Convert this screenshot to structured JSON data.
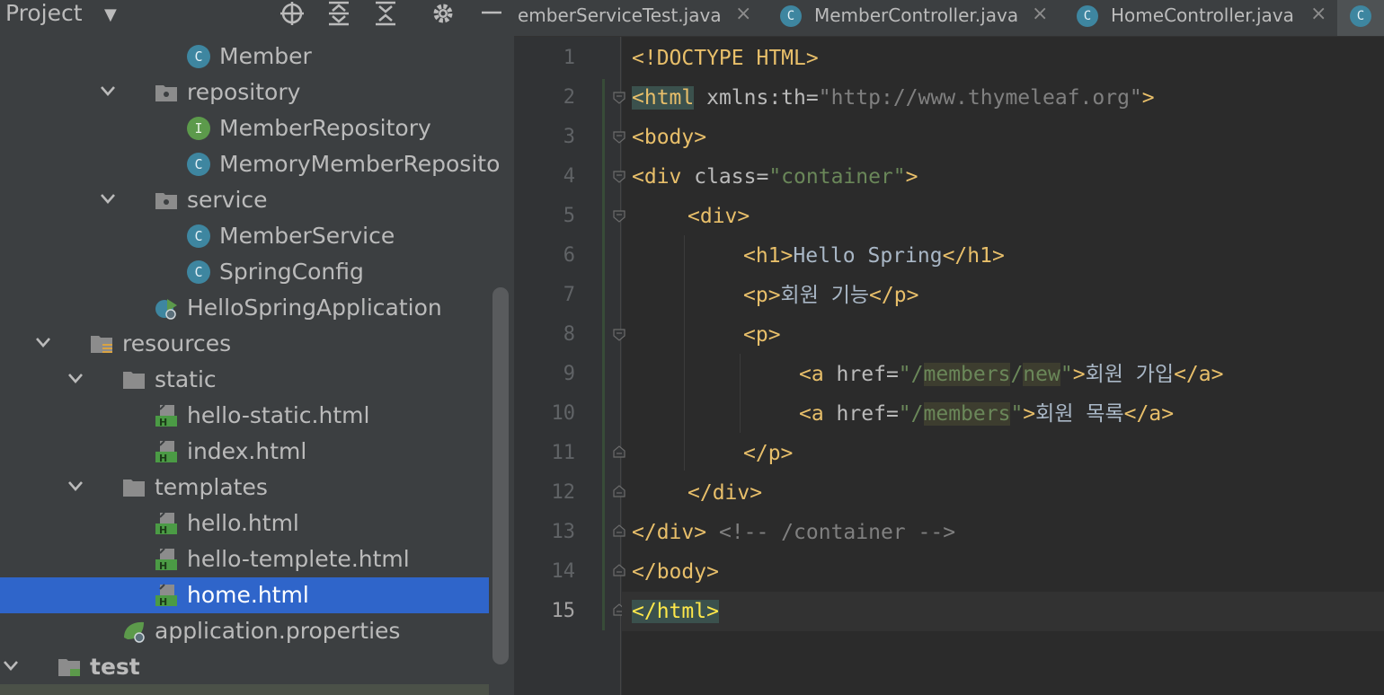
{
  "project_panel": {
    "title": "Project",
    "tree": [
      {
        "label": "Member",
        "icon": "class-c-icon",
        "indent": 3,
        "arrow": null
      },
      {
        "label": "repository",
        "icon": "package-folder-icon",
        "indent": 2,
        "arrow": "down"
      },
      {
        "label": "MemberRepository",
        "icon": "interface-i-icon",
        "indent": 3,
        "arrow": null
      },
      {
        "label": "MemoryMemberReposito",
        "icon": "class-c-icon",
        "indent": 3,
        "arrow": null
      },
      {
        "label": "service",
        "icon": "package-folder-icon",
        "indent": 2,
        "arrow": "down"
      },
      {
        "label": "MemberService",
        "icon": "class-c-icon",
        "indent": 3,
        "arrow": null
      },
      {
        "label": "SpringConfig",
        "icon": "class-c-icon",
        "indent": 3,
        "arrow": null
      },
      {
        "label": "HelloSpringApplication",
        "icon": "spring-app-icon",
        "indent": 2,
        "arrow": null
      },
      {
        "label": "resources",
        "icon": "resources-folder-icon",
        "indent": 0,
        "arrow": "down"
      },
      {
        "label": "static",
        "icon": "folder-icon",
        "indent": 1,
        "arrow": "down"
      },
      {
        "label": "hello-static.html",
        "icon": "html-file-icon",
        "indent": 2,
        "arrow": null
      },
      {
        "label": "index.html",
        "icon": "html-file-icon",
        "indent": 2,
        "arrow": null
      },
      {
        "label": "templates",
        "icon": "folder-icon",
        "indent": 1,
        "arrow": "down"
      },
      {
        "label": "hello.html",
        "icon": "html-file-icon",
        "indent": 2,
        "arrow": null
      },
      {
        "label": "hello-templete.html",
        "icon": "html-file-icon",
        "indent": 2,
        "arrow": null
      },
      {
        "label": "home.html",
        "icon": "html-file-icon",
        "indent": 2,
        "arrow": null,
        "selected": true
      },
      {
        "label": "application.properties",
        "icon": "spring-properties-icon",
        "indent": 1,
        "arrow": null
      },
      {
        "label": "test",
        "icon": "test-folder-icon",
        "indent": -1,
        "arrow": "down",
        "bold": true
      }
    ]
  },
  "tabs": [
    {
      "label": "emberServiceTest.java",
      "icon": null
    },
    {
      "label": "MemberController.java",
      "icon": "class-c-icon"
    },
    {
      "label": "HomeController.java",
      "icon": "class-c-icon"
    }
  ],
  "editor": {
    "line_numbers": [
      "1",
      "2",
      "3",
      "4",
      "5",
      "6",
      "7",
      "8",
      "9",
      "10",
      "11",
      "12",
      "13",
      "14",
      "15"
    ],
    "current_line": "15",
    "lines": {
      "l1": "<!DOCTYPE HTML>",
      "l2_open": "<",
      "l2_tag": "html",
      "l2_attr": " xmlns:th=",
      "l2_val": "\"http://www.thymeleaf.org\"",
      "l2_close": ">",
      "l3": "<body>",
      "l4_tag": "<div",
      "l4_attr": " class=",
      "l4_val": "\"container\"",
      "l4_close": ">",
      "l5": "<div>",
      "l6_open": "<h1>",
      "l6_text": "Hello Spring",
      "l6_close": "</h1>",
      "l7_open": "<p>",
      "l7_text": "회원 기능",
      "l7_close": "</p>",
      "l8": "<p>",
      "l9_tag": "<a",
      "l9_attr": " href=",
      "l9_q1": "\"/",
      "l9_w1": "members",
      "l9_slash": "/",
      "l9_w2": "new",
      "l9_q2": "\"",
      "l9_gt": ">",
      "l9_text": "회원 가입",
      "l9_close": "</a>",
      "l10_tag": "<a",
      "l10_attr": " href=",
      "l10_q1": "\"/",
      "l10_w1": "members",
      "l10_q2": "\"",
      "l10_gt": ">",
      "l10_text": "회원 목록",
      "l10_close": "</a>",
      "l11": "</p>",
      "l12": "</div>",
      "l13_tag": "</div>",
      "l13_comment": " <!-- /container -->",
      "l14": "</body>",
      "l15": "</html>"
    }
  },
  "colors": {
    "tag": "#e8bf6a",
    "string": "#6a8759",
    "attribute": "#bababa",
    "comment": "#808080",
    "selection": "#2f65ca"
  }
}
